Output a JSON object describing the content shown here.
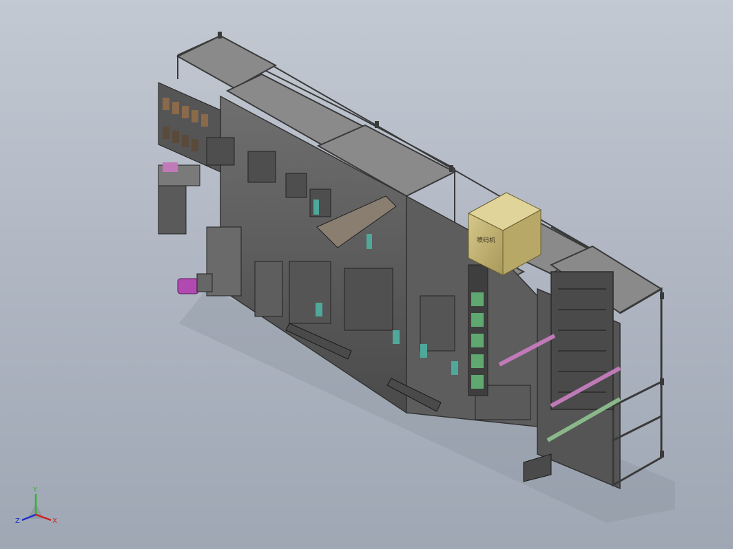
{
  "viewport": {
    "background_top": "#c3c9d2",
    "background_bottom": "#9fa7b4"
  },
  "model": {
    "frame_color": "#5c5c5c",
    "panel_color": "#6b6b6b",
    "box_label": "喷码机",
    "box_color": "#c9b978",
    "accent_teal": "#4fa89a",
    "accent_pink": "#c07ab8",
    "accent_green": "#6fb48a",
    "accent_brown": "#8a6a4a",
    "accent_magenta": "#b04ab0"
  },
  "triad": {
    "y_label": "Y",
    "x_label": "X",
    "z_label": "Z",
    "y_color": "#2db82d",
    "x_color": "#d02020",
    "z_color": "#2030c8"
  }
}
